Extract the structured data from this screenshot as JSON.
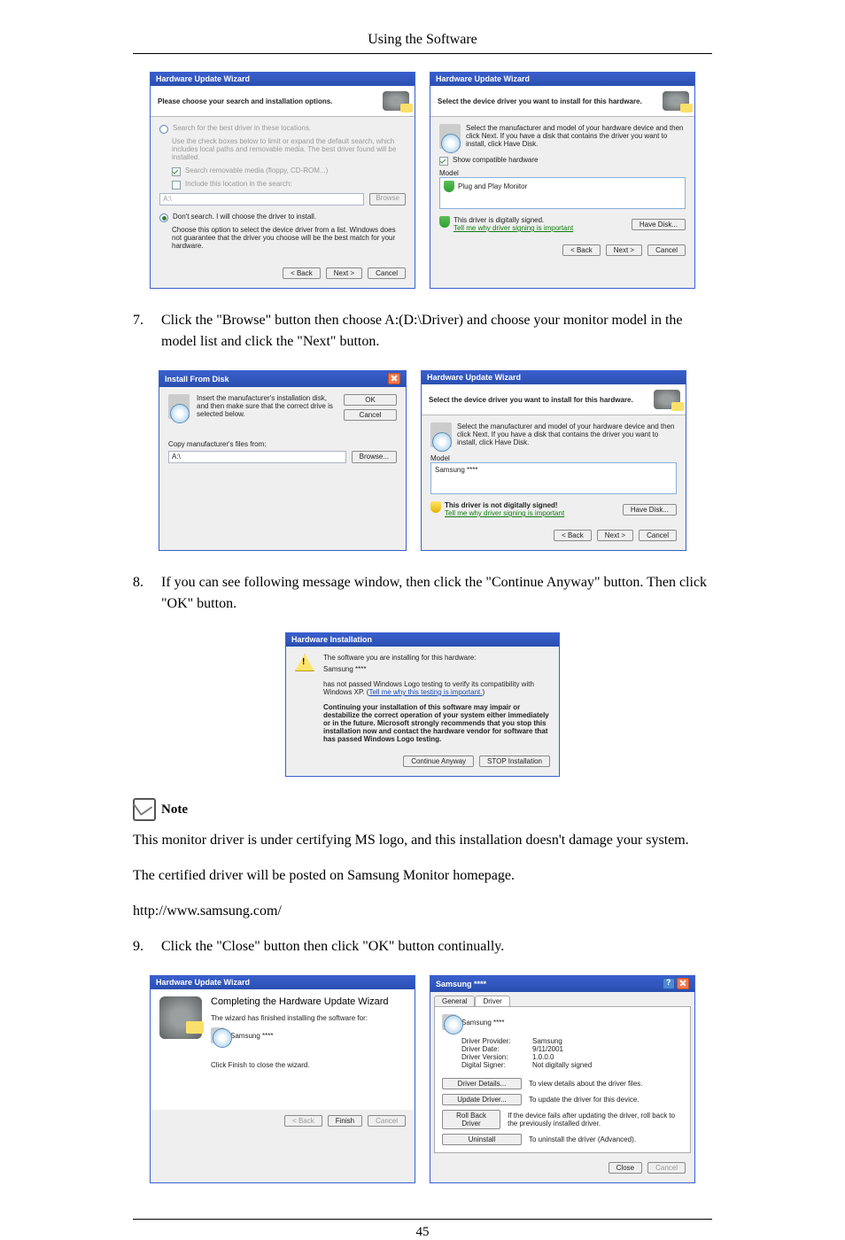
{
  "page": {
    "header": "Using the Software",
    "number": "45"
  },
  "step7": {
    "num": "7.",
    "text": "Click the \"Browse\" button then choose A:(D:\\Driver) and choose your monitor model in the model list and click the \"Next\" button."
  },
  "step8": {
    "num": "8.",
    "text": "If you can see following message window, then click the \"Continue Anyway\" button. Then click \"OK\" button."
  },
  "step9": {
    "num": "9.",
    "text": "Click the \"Close\" button then click \"OK\" button continually."
  },
  "note_label": "Note",
  "note_p1": "This monitor driver is under certifying MS logo, and this installation doesn't damage your system.",
  "note_p2": "The certified driver will be posted on Samsung Monitor homepage.",
  "note_url": "http://www.samsung.com/",
  "dlg_search": {
    "title": "Hardware Update Wizard",
    "header": "Please choose your search and installation options.",
    "r1": "Search for the best driver in these locations.",
    "r1_sub": "Use the check boxes below to limit or expand the default search, which includes local paths and removable media. The best driver found will be installed.",
    "chk1": "Search removable media (floppy, CD-ROM...)",
    "chk2": "Include this location in the search:",
    "path": "A:\\",
    "browse": "Browse",
    "r2": "Don't search. I will choose the driver to install.",
    "r2_sub": "Choose this option to select the device driver from a list. Windows does not guarantee that the driver you choose will be the best match for your hardware.",
    "back": "< Back",
    "next": "Next >",
    "cancel": "Cancel"
  },
  "dlg_select": {
    "title": "Hardware Update Wizard",
    "header": "Select the device driver you want to install for this hardware.",
    "info": "Select the manufacturer and model of your hardware device and then click Next. If you have a disk that contains the driver you want to install, click Have Disk.",
    "chk": "Show compatible hardware",
    "model_h": "Model",
    "model_item": "Plug and Play Monitor",
    "signed": "This driver is digitally signed.",
    "tell": "Tell me why driver signing is important",
    "have": "Have Disk...",
    "back": "< Back",
    "next": "Next >",
    "cancel": "Cancel"
  },
  "dlg_insert": {
    "title": "Install From Disk",
    "msg": "Insert the manufacturer's installation disk, and then make sure that the correct drive is selected below.",
    "ok": "OK",
    "cancel": "Cancel",
    "copy": "Copy manufacturer's files from:",
    "path": "A:\\",
    "browse": "Browse..."
  },
  "dlg_select2": {
    "title": "Hardware Update Wizard",
    "header": "Select the device driver you want to install for this hardware.",
    "info": "Select the manufacturer and model of your hardware device and then click Next. If you have a disk that contains the driver you want to install, click Have Disk.",
    "model_h": "Model",
    "model_item": "Samsung ****",
    "unsigned": "This driver is not digitally signed!",
    "tell": "Tell me why driver signing is important",
    "have": "Have Disk...",
    "back": "< Back",
    "next": "Next >",
    "cancel": "Cancel"
  },
  "dlg_warn": {
    "title": "Hardware Installation",
    "l1": "The software you are installing for this hardware:",
    "l2": "Samsung ****",
    "l3": "has not passed Windows Logo testing to verify its compatibility with Windows XP. (",
    "l3b": "Tell me why this testing is important.",
    "l3c": ")",
    "bold": "Continuing your installation of this software may impair or destabilize the correct operation of your system either immediately or in the future. Microsoft strongly recommends that you stop this installation now and contact the hardware vendor for software that has passed Windows Logo testing.",
    "cont": "Continue Anyway",
    "stop": "STOP Installation"
  },
  "dlg_complete": {
    "title": "Hardware Update Wizard",
    "h": "Completing the Hardware Update Wizard",
    "sub": "The wizard has finished installing the software for:",
    "dev": "Samsung ****",
    "close": "Click Finish to close the wizard.",
    "back": "< Back",
    "finish": "Finish",
    "cancel": "Cancel"
  },
  "dlg_prop": {
    "title": "Samsung ****",
    "tab_general": "General",
    "tab_driver": "Driver",
    "dev": "Samsung ****",
    "rows": {
      "provider_k": "Driver Provider:",
      "provider_v": "Samsung",
      "date_k": "Driver Date:",
      "date_v": "9/11/2001",
      "ver_k": "Driver Version:",
      "ver_v": "1.0.0.0",
      "sign_k": "Digital Signer:",
      "sign_v": "Not digitally signed"
    },
    "btns": {
      "details": "Driver Details...",
      "details_t": "To view details about the driver files.",
      "update": "Update Driver...",
      "update_t": "To update the driver for this device.",
      "roll": "Roll Back Driver",
      "roll_t": "If the device fails after updating the driver, roll back to the previously installed driver.",
      "uninst": "Uninstall",
      "uninst_t": "To uninstall the driver (Advanced)."
    },
    "close": "Close",
    "cancel": "Cancel"
  }
}
